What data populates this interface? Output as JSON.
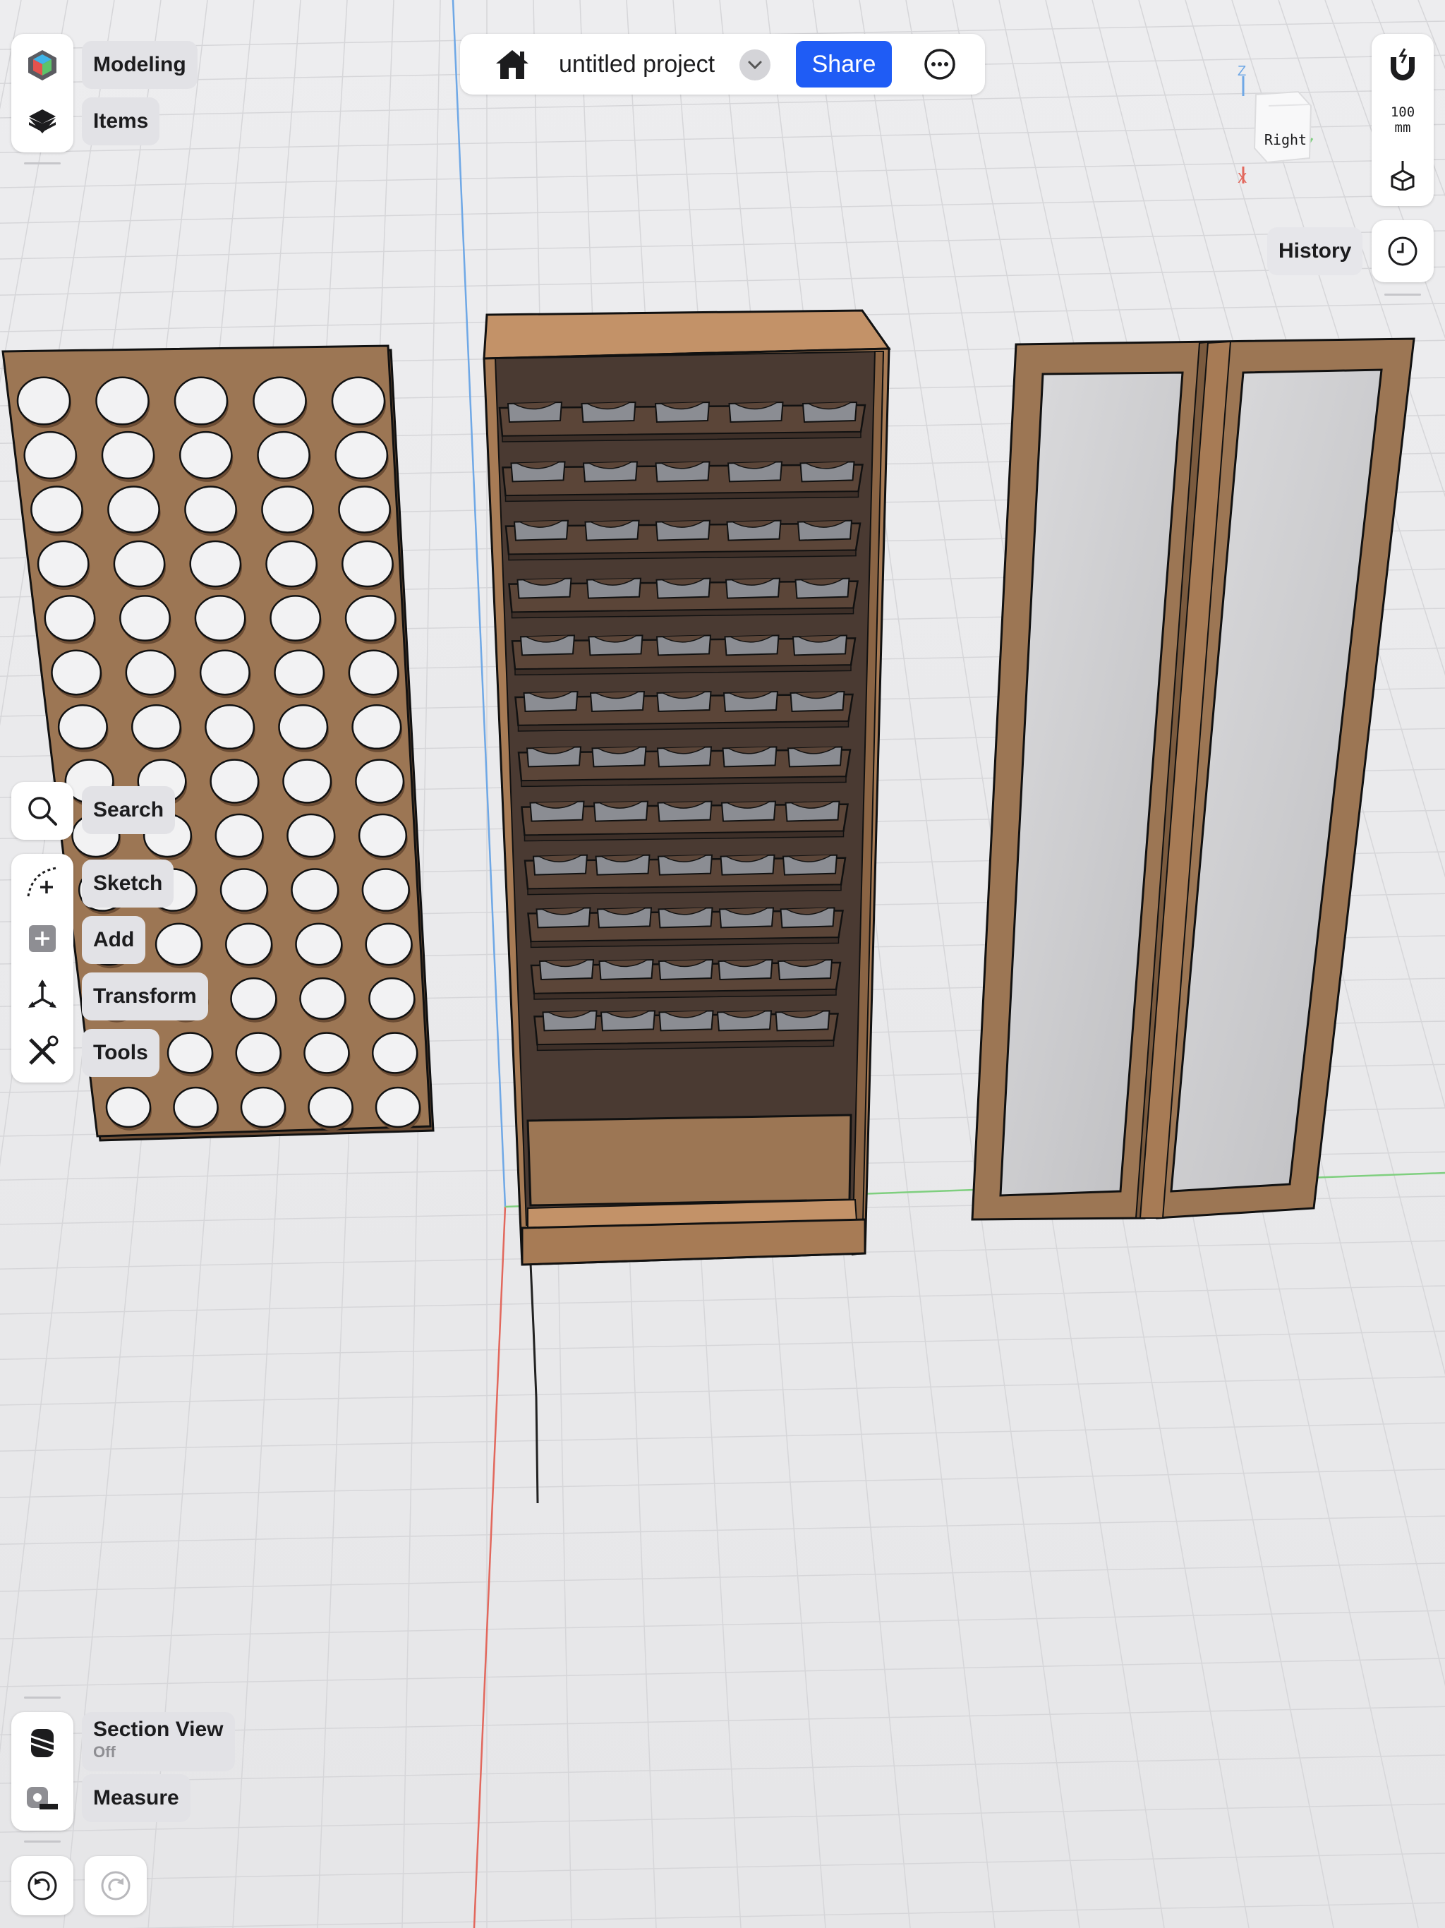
{
  "app": {
    "project_title": "untitled project",
    "share_label": "Share"
  },
  "left_top": {
    "modeling_label": "Modeling",
    "items_label": "Items"
  },
  "left_tools": {
    "search_label": "Search",
    "sketch_label": "Sketch",
    "add_label": "Add",
    "transform_label": "Transform",
    "tools_label": "Tools"
  },
  "left_bottom": {
    "section_view_label": "Section View",
    "section_view_state": "Off",
    "measure_label": "Measure"
  },
  "right_panel": {
    "grid_scale_value": "100",
    "grid_scale_unit": "mm",
    "history_label": "History"
  },
  "view_cube": {
    "face_label": "Right",
    "axis_z": "Z",
    "axis_x": "X"
  },
  "colors": {
    "accent_blue": "#1f5cf5",
    "wood": "#9c7654",
    "wood_light": "#c09166",
    "cabinet_interior": "#4a3a32",
    "glass": "#c8c8ca",
    "axis_blue": "#6fa8e6",
    "axis_red": "#e2685d",
    "axis_green": "#7fcf7f"
  },
  "model": {
    "pegboard_columns": 5,
    "pegboard_rows": 14,
    "cabinet_shelves": 12,
    "shelf_slots": 5,
    "door_count": 2
  }
}
